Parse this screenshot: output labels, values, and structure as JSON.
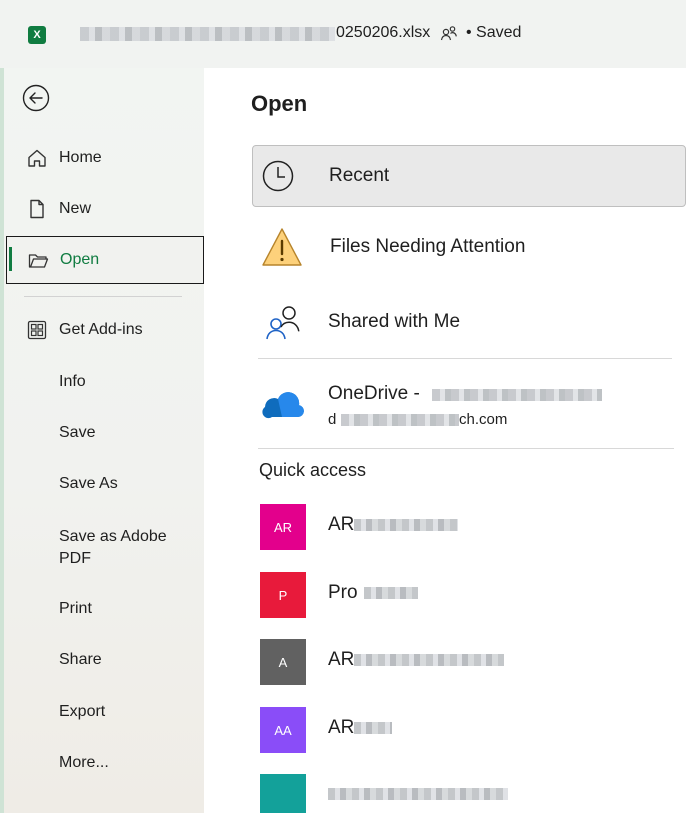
{
  "titlebar": {
    "filename_suffix": "0250206.xlsx",
    "status": "• Saved"
  },
  "nav": {
    "items": [
      {
        "label": "Home",
        "icon": "home-icon"
      },
      {
        "label": "New",
        "icon": "new-file-icon"
      },
      {
        "label": "Open",
        "icon": "folder-open-icon",
        "active": true
      },
      {
        "label": "Get Add-ins",
        "icon": "addins-grid-icon"
      },
      {
        "label": "Info"
      },
      {
        "label": "Save"
      },
      {
        "label": "Save As"
      },
      {
        "label": "Save as Adobe PDF"
      },
      {
        "label": "Print"
      },
      {
        "label": "Share"
      },
      {
        "label": "Export"
      },
      {
        "label": "More..."
      }
    ]
  },
  "main": {
    "title": "Open",
    "locations": [
      {
        "label": "Recent",
        "icon": "clock-icon",
        "selected": true
      },
      {
        "label": "Files Needing Attention",
        "icon": "warning-icon"
      },
      {
        "label": "Shared with Me",
        "icon": "shared-people-icon"
      },
      {
        "label": "OneDrive -",
        "sublabel": "ch.com",
        "icon": "onedrive-cloud-icon"
      }
    ],
    "quick_access_title": "Quick access",
    "quick_access": [
      {
        "badge": "AR",
        "label": "AR",
        "color": "#e3008c"
      },
      {
        "badge": "P",
        "label": "Pro",
        "color": "#e81a3b"
      },
      {
        "badge": "A",
        "label": "AR",
        "color": "#616161"
      },
      {
        "badge": "AA",
        "label": "AR",
        "color": "#8a4df8"
      },
      {
        "badge": "",
        "label": "",
        "color": "#13a19a"
      }
    ]
  },
  "colors": {
    "accent": "#107c41",
    "rail_bg": "#f1f2ef"
  }
}
